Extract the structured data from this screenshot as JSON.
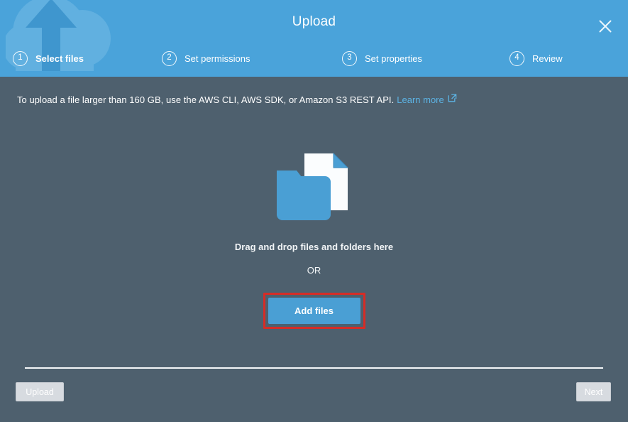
{
  "window": {
    "title": "Upload",
    "close_icon": "close-x-icon",
    "watermark_icon": "cloud-upload-icon",
    "header_color": "#4aa3da",
    "body_color": "#4e606e"
  },
  "steps": [
    {
      "number": "1",
      "label": "Select files",
      "active": true
    },
    {
      "number": "2",
      "label": "Set permissions",
      "active": false
    },
    {
      "number": "3",
      "label": "Set properties",
      "active": false
    },
    {
      "number": "4",
      "label": "Review",
      "active": false
    }
  ],
  "info": {
    "message": "To upload a file larger than 160 GB, use the AWS CLI, AWS SDK, or Amazon S3 REST API.",
    "link_label": "Learn more",
    "link_icon": "external-link-icon",
    "link_color": "#5cb3e4"
  },
  "dropzone": {
    "icon": "folder-document-icon",
    "primary_text": "Drag and drop files and folders here",
    "or_text": "OR",
    "add_files_label": "Add files",
    "add_files_color": "#4a9fd4",
    "highlight_color": "#d62c26"
  },
  "footer": {
    "upload_label": "Upload",
    "next_label": "Next",
    "disabled_color": "#d7dbe0"
  }
}
